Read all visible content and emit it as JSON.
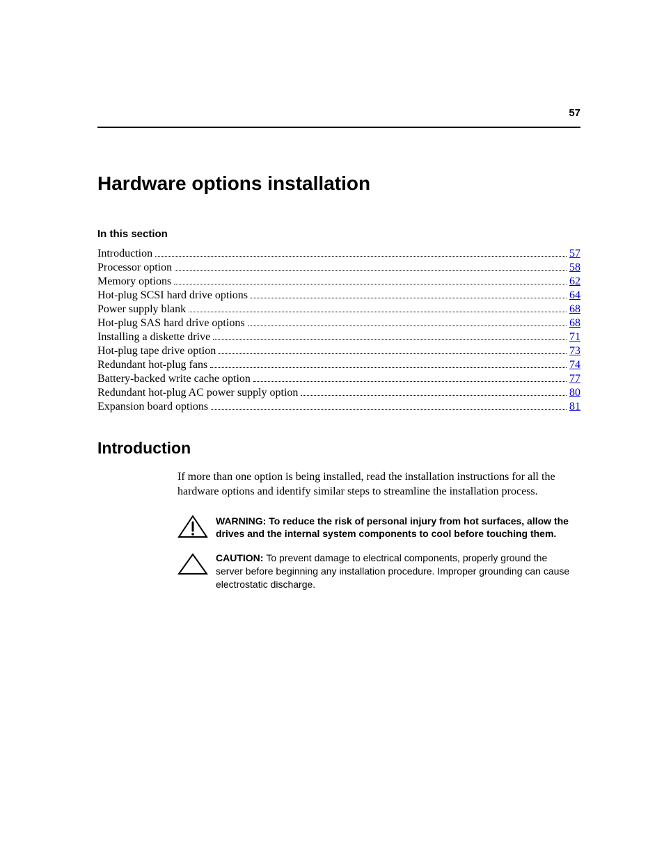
{
  "page_number": "57",
  "chapter_title": "Hardware options installation",
  "in_this_section": "In this section",
  "toc": [
    {
      "label": "Introduction",
      "page": "57"
    },
    {
      "label": "Processor option",
      "page": "58"
    },
    {
      "label": "Memory options",
      "page": "62"
    },
    {
      "label": "Hot-plug SCSI hard drive options",
      "page": "64"
    },
    {
      "label": "Power supply blank",
      "page": "68"
    },
    {
      "label": "Hot-plug SAS hard drive options",
      "page": "68"
    },
    {
      "label": "Installing a diskette drive",
      "page": "71"
    },
    {
      "label": "Hot-plug tape drive option",
      "page": "73"
    },
    {
      "label": "Redundant hot-plug fans",
      "page": "74"
    },
    {
      "label": "Battery-backed write cache option",
      "page": "77"
    },
    {
      "label": "Redundant hot-plug AC power supply option",
      "page": "80"
    },
    {
      "label": "Expansion board options",
      "page": "81"
    }
  ],
  "section_title": "Introduction",
  "intro_paragraph": "If more than one option is being installed, read the installation instructions for all the hardware options and identify similar steps to streamline the installation process.",
  "warning": {
    "label": "WARNING:  ",
    "text": "To reduce the risk of personal injury from hot surfaces, allow the drives and the internal system components to cool before touching them."
  },
  "caution": {
    "label": "CAUTION:  ",
    "text": "To prevent damage to electrical components, properly ground the server before beginning any installation procedure. Improper grounding can cause electrostatic discharge."
  }
}
